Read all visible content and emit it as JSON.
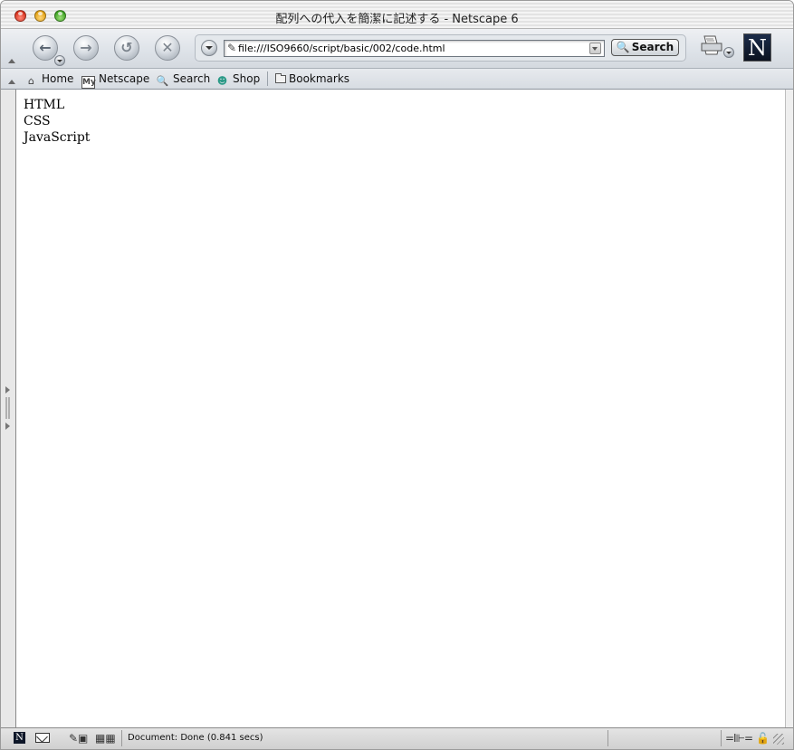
{
  "window": {
    "title": "配列への代入を簡潔に記述する - Netscape 6"
  },
  "navigation": {
    "back_icon": "back-arrow-icon",
    "forward_icon": "forward-arrow-icon",
    "reload_icon": "reload-icon",
    "stop_icon": "stop-icon",
    "url": "file:///ISO9660/script/basic/002/code.html",
    "search_label": "Search"
  },
  "personal_toolbar": {
    "items": [
      {
        "label": "Home",
        "icon": "home-icon"
      },
      {
        "label": "Netscape",
        "icon": "my-netscape-icon"
      },
      {
        "label": "Search",
        "icon": "search-icon"
      },
      {
        "label": "Shop",
        "icon": "shop-icon"
      }
    ],
    "bookmarks_label": "Bookmarks"
  },
  "content": {
    "lines": [
      "HTML",
      "CSS",
      "JavaScript"
    ]
  },
  "statusbar": {
    "text": "Document: Done (0.841 secs)"
  },
  "colors": {
    "toolbar_bg": "#dde2e8",
    "content_bg": "#ffffff",
    "shop_accent": "#2a9a87"
  }
}
